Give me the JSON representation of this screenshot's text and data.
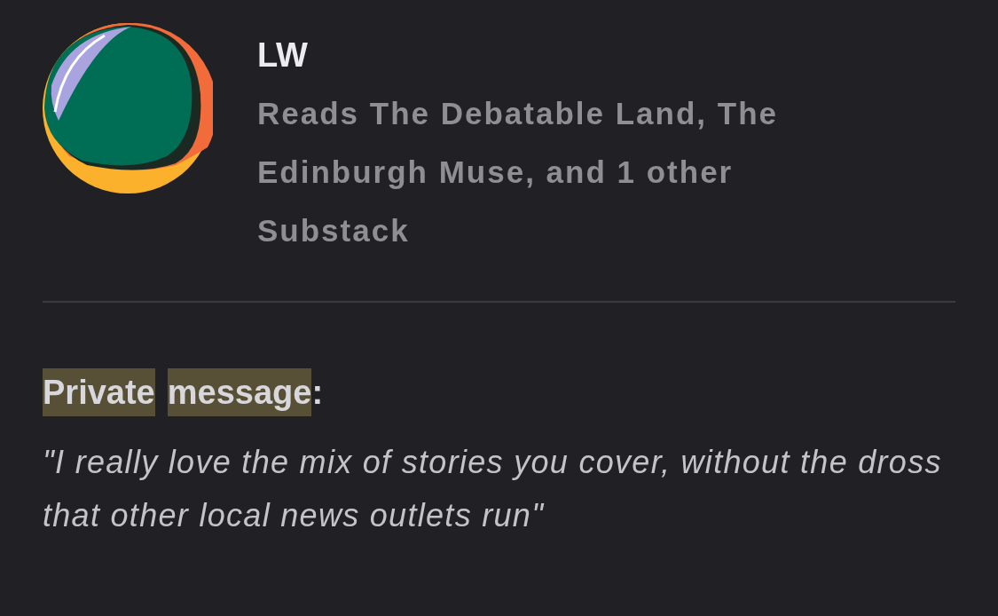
{
  "profile": {
    "name": "LW",
    "description": "Reads The Debatable Land, The Edinburgh Muse, and 1 other Substack"
  },
  "message": {
    "heading": [
      {
        "text": "Private",
        "highlighted": true
      },
      {
        "text": "message",
        "highlighted": true
      },
      {
        "text": ":",
        "highlighted": false
      }
    ],
    "body": "\"I really love the mix of stories you cover, without the dross that other local news outlets run\""
  }
}
